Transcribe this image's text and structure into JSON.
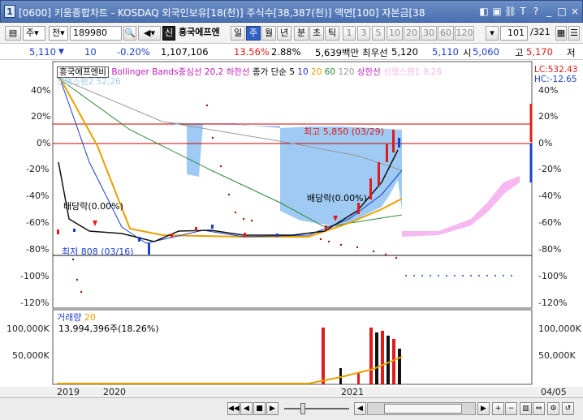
{
  "window": {
    "title": "[0600] 키움종합차트 - KOSDAQ 외국인보유[18(천)] 주식수[38,387(천)] 액면[100] 자본금[38"
  },
  "toolbar": {
    "period_type": "주",
    "price_mode": "전",
    "stock_code": "189980",
    "badge": "신",
    "stock_name": "흥국에프엔",
    "tabs": [
      "일",
      "주",
      "월",
      "년",
      "분",
      "초",
      "틱"
    ],
    "intervals": [
      "1",
      "3",
      "5",
      "10",
      "20",
      "30",
      "60",
      "120"
    ],
    "page_current": "101",
    "page_total": "/321"
  },
  "infobar": {
    "price": "5,110",
    "change": "10",
    "change_pct": "-0.20%",
    "volume": "1,107,106",
    "turnover": "13.56%",
    "ratio": "2.88%",
    "amount": "5,639백만",
    "label_preferred": "최우선",
    "best_price": "5,120",
    "price2": "5,110",
    "label_open": "시",
    "open": "5,060",
    "label_high": "고",
    "high": "5,170",
    "label_low": "저"
  },
  "legend": {
    "stock": "흥국에프엔비",
    "bollinger": "Bollinger Bands중심선 20,2",
    "lower": "하한선",
    "ma_label": "종가 단순",
    "ma": [
      "5",
      "10",
      "20",
      "60",
      "120"
    ],
    "upper": "상한선",
    "span1": "선행스팬1 9,26",
    "span2": "선행스팬2 52,26",
    "lc": "LC:532.43",
    "hc": "HC:-12.65"
  },
  "annotations": {
    "high": "최고 5,850 (03/29)",
    "low": "최저 808 (03/16)",
    "div_left": "배당락(0.00%)",
    "div_right": "배당락(0.00%)"
  },
  "price_axis": [
    "40%",
    "20%",
    "0%",
    "-20%",
    "-40%",
    "-60%",
    "-80%",
    "-100%",
    "-120%"
  ],
  "volume_panel": {
    "label": "거래량",
    "ma": "20",
    "value": "13,994,396주(18.26%)",
    "axis": [
      "100,000K",
      "50,000K"
    ]
  },
  "date_axis": [
    "2019",
    "2020",
    "2021",
    "04/05"
  ],
  "colors": {
    "title_bar": "#4a6fb0",
    "selected_tab": "#2f62c6",
    "up": "#e01b1b",
    "down": "#1b3fcf",
    "cloud": "#9fcaf3",
    "cloud2": "#f6b8f0"
  }
}
